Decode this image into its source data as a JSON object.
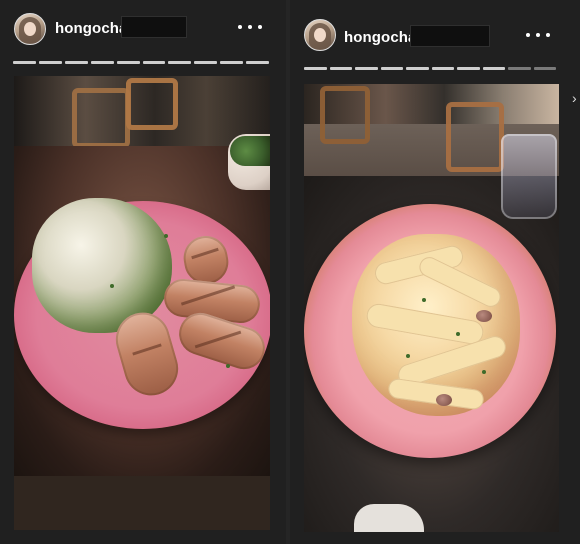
{
  "stories": [
    {
      "username": "hongocha",
      "progress": [
        1,
        1,
        1,
        1,
        1,
        1,
        1,
        1,
        1,
        1
      ],
      "photo": {
        "icon": "salad-plate-icon"
      }
    },
    {
      "username": "hongocha",
      "progress": [
        1,
        1,
        1,
        1,
        1,
        1,
        1,
        1,
        0.4,
        0
      ],
      "photo": {
        "icon": "pasta-plate-icon"
      }
    }
  ],
  "ui": {
    "more_icon": "more-icon",
    "next_icon": "chevron-right-icon"
  }
}
